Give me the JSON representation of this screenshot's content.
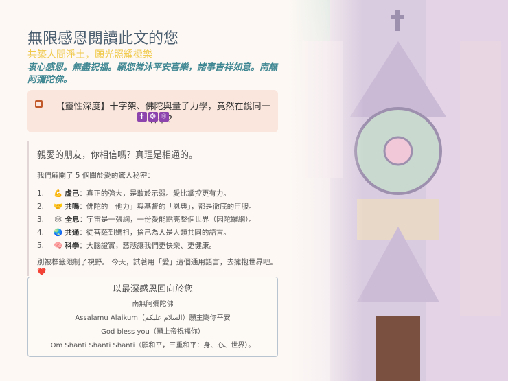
{
  "title": "無限感恩閱讀此文的您",
  "subtitle": "共築人間淨土，願光照耀極樂",
  "blessing": "衷心感恩。無盡祝福。願您常沐平安喜樂，諸事吉祥如意。南無阿彌陀佛。",
  "card": {
    "icon": "note-icon",
    "text": "【靈性深度】十字架、佛陀與量子力學，竟然在說同一件事？",
    "emojis": [
      "✝",
      "☸",
      "⚛"
    ]
  },
  "intro": "親愛的朋友，你相信嗎？真理是相通的。",
  "lead": "我們解開了 5 個關於愛的驚人秘密：",
  "items": [
    {
      "num": "1.",
      "emoji": "💪",
      "key": "虛己",
      "text": "：真正的強大，是敢於示弱。愛比掌控更有力。"
    },
    {
      "num": "2.",
      "emoji": "🤝",
      "key": "共鳴",
      "text": "：佛陀的「他力」與基督的「恩典」，都是徹底的臣服。"
    },
    {
      "num": "3.",
      "emoji": "🕸",
      "key": "全息",
      "text": "：宇宙是一張網，一份愛能點亮整個世界（因陀羅網）。"
    },
    {
      "num": "4.",
      "emoji": "🌏",
      "key": "共通",
      "text": "：從菩薩到媽祖，捨己為人是人類共同的語言。"
    },
    {
      "num": "5.",
      "emoji": "🧠",
      "key": "科學",
      "text": "：大腦證實，慈悲讓我們更快樂、更健康。"
    }
  ],
  "closing": "別被標籤限制了視野。 今天，試著用「愛」這個通用語言，去擁抱世界吧。❤️",
  "box": {
    "heading": "以最深感恩回向於您",
    "lines": [
      "南無阿彌陀佛",
      "Assalamu Alaikum（السلام عليكم）願主賜你平安",
      "God bless you（願上帝祝福你）",
      "Om Shanti Shanti Shanti（願和平，三重和平：身、心、世界）。"
    ]
  }
}
